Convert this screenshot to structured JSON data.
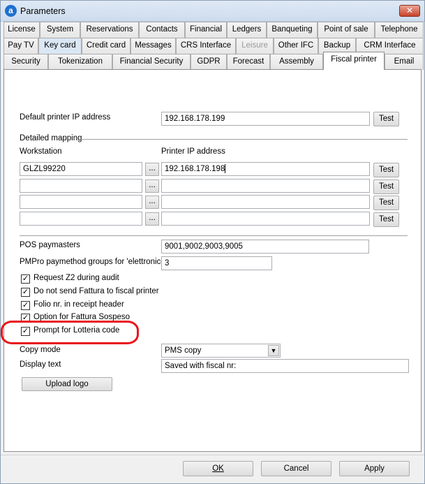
{
  "window": {
    "title": "Parameters",
    "icon": "app-logo-icon",
    "close_glyph": "✕"
  },
  "tabs": {
    "row1": [
      "License",
      "System",
      "Reservations",
      "Contacts",
      "Financial",
      "Ledgers",
      "Banqueting",
      "Point of sale",
      "Telephone"
    ],
    "row2": [
      "Pay TV",
      "Key card",
      "Credit card",
      "Messages",
      "CRS Interface",
      "Leisure",
      "Other IFC",
      "Backup",
      "CRM Interface"
    ],
    "row3": [
      "Security",
      "Tokenization",
      "Financial Security",
      "GDPR",
      "Forecast",
      "Assembly",
      "Fiscal printer",
      "Email"
    ],
    "active": "Fiscal printer",
    "disabled": [
      "Leisure"
    ]
  },
  "fiscal_printer": {
    "default_ip_label": "Default printer IP address",
    "default_ip_value": "192.168.178.199",
    "test_label": "Test",
    "detailed_mapping_label": "Detailed mapping",
    "workstation_header": "Workstation",
    "printer_ip_header": "Printer IP address",
    "browse_label": "...",
    "mapping_rows": [
      {
        "workstation": "GLZL99220",
        "ip": "192.168.178.198"
      },
      {
        "workstation": "",
        "ip": ""
      },
      {
        "workstation": "",
        "ip": ""
      },
      {
        "workstation": "",
        "ip": ""
      }
    ],
    "pos_paymasters_label": "POS paymasters",
    "pos_paymasters_value": "9001,9002,9003,9005",
    "pmpro_label": "PMPro paymethod groups for 'elettronico'",
    "pmpro_value": "3",
    "checkboxes": [
      {
        "label": "Request Z2 during audit",
        "checked": true
      },
      {
        "label": "Do not send Fattura to fiscal printer",
        "checked": true
      },
      {
        "label": "Folio nr. in receipt header",
        "checked": true
      },
      {
        "label": "Option for Fattura Sospeso",
        "checked": true
      },
      {
        "label": "Prompt for Lotteria code",
        "checked": true
      }
    ],
    "check_glyph": "✓",
    "copy_mode_label": "Copy mode",
    "copy_mode_value": "PMS copy",
    "display_text_label": "Display text",
    "display_text_value": "Saved with fiscal nr:",
    "upload_logo_label": "Upload logo"
  },
  "footer": {
    "ok_label": "OK",
    "cancel_label": "Cancel",
    "apply_label": "Apply"
  },
  "colors": {
    "highlight": "#e8151a",
    "titlebar": "#cddcee",
    "panel": "#ffffff"
  }
}
